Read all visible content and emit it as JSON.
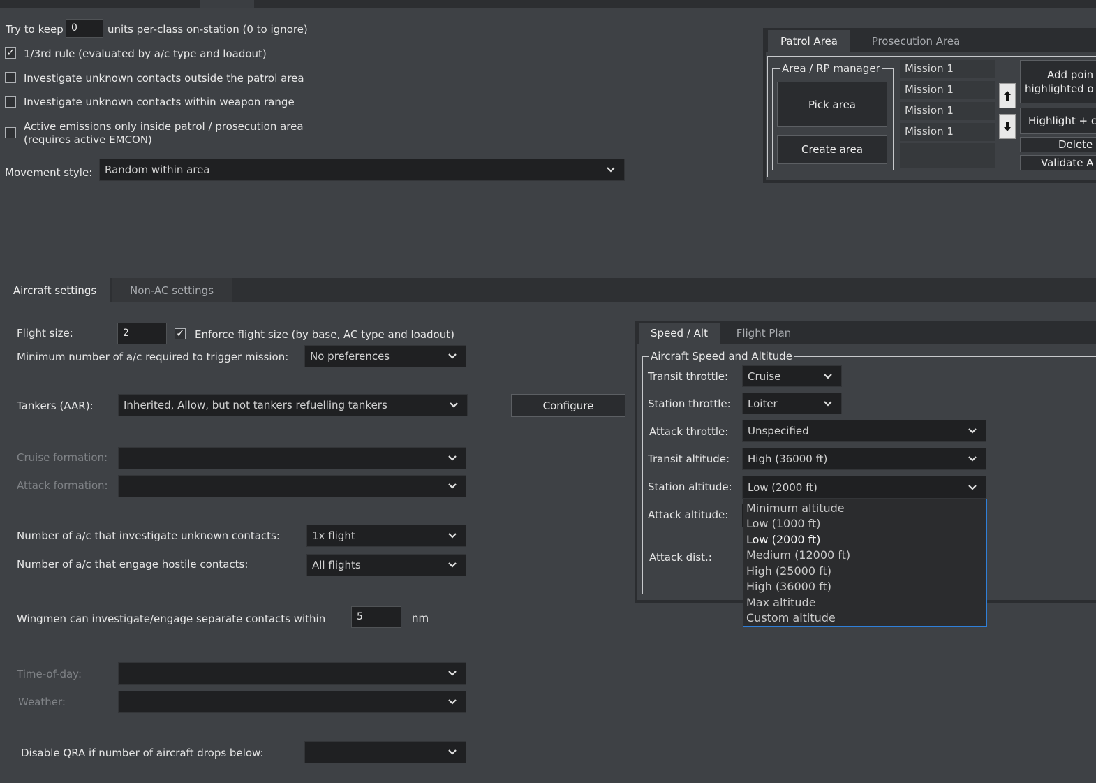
{
  "patrol": {
    "try_keep_prefix": "Try to keep",
    "try_keep_value": "0",
    "try_keep_suffix": "units per-class on-station (0 to ignore)",
    "rule13": "1/3rd rule (evaluated by a/c type and loadout)",
    "rule13_checked": true,
    "investigate_outside": "Investigate unknown contacts outside the patrol area",
    "investigate_weapon": "Investigate unknown contacts within weapon range",
    "active_emissions_line1": "Active emissions only inside patrol / prosecution area",
    "active_emissions_line2": "(requires active EMCON)",
    "movement_label": "Movement style:",
    "movement_value": "Random within area"
  },
  "area_panel": {
    "tabs": [
      "Patrol Area",
      "Prosecution Area"
    ],
    "group_title": "Area / RP manager",
    "pick_area": "Pick area",
    "create_area": "Create area",
    "rp_list": [
      "Mission 1",
      "Mission 1",
      "Mission 1",
      "Mission 1"
    ],
    "add_point_line1": "Add poin",
    "add_point_line2": "highlighted o",
    "highlight": "Highlight + c",
    "delete": "Delete",
    "validate": "Validate A",
    "up_icon": "arrow-up-icon",
    "down_icon": "arrow-down-icon"
  },
  "settings_tabs": [
    "Aircraft settings",
    "Non-AC settings"
  ],
  "aircraft": {
    "flight_size_label": "Flight size:",
    "flight_size_value": "2",
    "enforce_label": "Enforce flight size (by base, AC type and loadout)",
    "enforce_checked": true,
    "min_ac_label": "Minimum number of a/c required to trigger mission:",
    "min_ac_value": "No preferences",
    "tankers_label": "Tankers (AAR):",
    "tankers_value": "Inherited, Allow, but not tankers refuelling tankers",
    "configure": "Configure",
    "cruise_formation_label": "Cruise formation:",
    "attack_formation_label": "Attack formation:",
    "investigate_label": "Number of a/c that investigate unknown contacts:",
    "investigate_value": "1x flight",
    "engage_label": "Number of a/c that engage hostile contacts:",
    "engage_value": "All flights",
    "wingmen_label": "Wingmen can investigate/engage separate contacts within",
    "wingmen_value": "5",
    "wingmen_unit": "nm",
    "tod_label": "Time-of-day:",
    "weather_label": "Weather:",
    "qra_label": "Disable QRA if number of aircraft drops below:"
  },
  "speed_panel": {
    "tabs": [
      "Speed / Alt",
      "Flight Plan"
    ],
    "group_title": "Aircraft Speed and Altitude",
    "transit_throttle_label": "Transit throttle:",
    "transit_throttle_value": "Cruise",
    "station_throttle_label": "Station throttle:",
    "station_throttle_value": "Loiter",
    "attack_throttle_label": "Attack throttle:",
    "attack_throttle_value": "Unspecified",
    "transit_alt_label": "Transit altitude:",
    "transit_alt_value": "High (36000 ft)",
    "station_alt_label": "Station altitude:",
    "station_alt_value": "Low (2000 ft)",
    "attack_alt_label": "Attack altitude:",
    "attack_dist_label": "Attack dist.:"
  },
  "altitude_dropdown": {
    "options": [
      "Minimum altitude",
      "Low (1000 ft)",
      "Low (2000 ft)",
      "Medium (12000 ft)",
      "High (25000 ft)",
      "High (36000 ft)",
      "Max altitude",
      "Custom altitude"
    ],
    "selected": "Low (2000 ft)"
  },
  "colors": {
    "background": "#3e4145",
    "field": "#1f2022",
    "popup_border": "#2f7fd8"
  }
}
